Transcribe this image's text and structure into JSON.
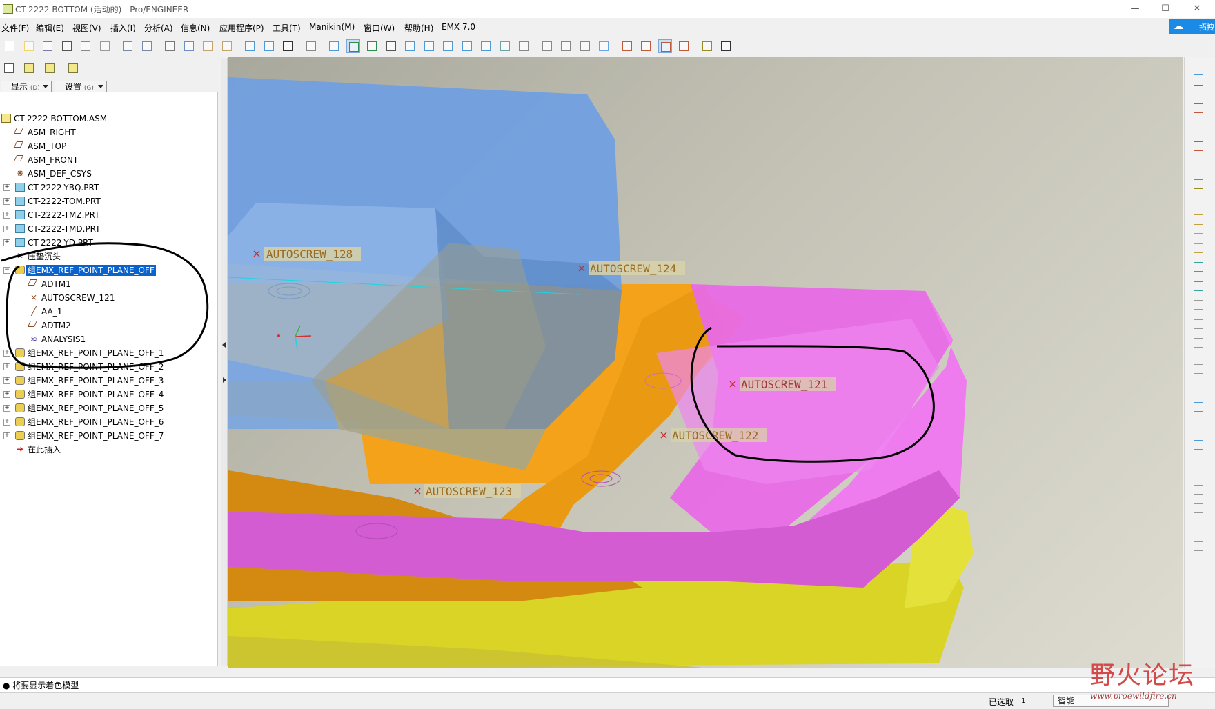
{
  "window": {
    "title": "CT-2222-BOTTOM (活动的) - Pro/ENGINEER",
    "minimize_glyph": "—",
    "maximize_glyph": "☐",
    "close_glyph": "✕"
  },
  "menubar": {
    "items": [
      "文件(F)",
      "编辑(E)",
      "视图(V)",
      "插入(I)",
      "分析(A)",
      "信息(N)",
      "应用程序(P)",
      "工具(T)",
      "Manikin(M)",
      "窗口(W)",
      "帮助(H)",
      "EMX 7.0"
    ]
  },
  "cloud_button": {
    "label": "拓拽",
    "icon": "baidu-cloud-icon"
  },
  "toolbar": {
    "icons": [
      "new-icon",
      "open-icon",
      "save-icon",
      "print-icon",
      "print-preview-icon",
      "email-icon",
      "undo-icon",
      "redo-icon",
      "cut-icon",
      "copy-icon",
      "paste-icon",
      "paste-special-icon",
      "regenerate-icon",
      "regen-manager-icon",
      "find-icon",
      "select-box-icon",
      "redraw-icon",
      "spin-center-icon",
      "orient-icon",
      "pan-icon",
      "zoom-in-icon",
      "zoom-out-icon",
      "refit-icon",
      "reorient-icon",
      "saved-views-icon",
      "layers-icon",
      "view-manager-icon",
      "wireframe-icon",
      "hidden-line-icon",
      "no-hidden-icon",
      "shading-icon",
      "datum-planes-icon",
      "datum-axes-icon",
      "datum-points-icon",
      "csys-icon",
      "annotations-icon",
      "whats-this-icon"
    ]
  },
  "left_panel": {
    "tab_icons": [
      "model-tree-icon",
      "layer-tree-icon",
      "favorites-icon",
      "browser-icon"
    ],
    "show_dropdown": {
      "label": "显示",
      "key": "(D)"
    },
    "settings_dropdown": {
      "label": "设置",
      "key": "(G)"
    }
  },
  "tree": {
    "items": [
      {
        "label": "CT-2222-BOTTOM.ASM",
        "icon": "asm"
      },
      {
        "label": "ASM_RIGHT",
        "icon": "plane"
      },
      {
        "label": "ASM_TOP",
        "icon": "plane"
      },
      {
        "label": "ASM_FRONT",
        "icon": "plane"
      },
      {
        "label": "ASM_DEF_CSYS",
        "icon": "csys"
      },
      {
        "label": "CT-2222-YBQ.PRT",
        "icon": "prt"
      },
      {
        "label": "CT-2222-TOM.PRT",
        "icon": "prt"
      },
      {
        "label": "CT-2222-TMZ.PRT",
        "icon": "prt"
      },
      {
        "label": "CT-2222-TMD.PRT",
        "icon": "prt"
      },
      {
        "label": "CT-2222-YD.PRT",
        "icon": "prt"
      },
      {
        "label": "压垫沉头",
        "icon": "ctr"
      },
      {
        "label": "组EMX_REF_POINT_PLANE_OFF",
        "icon": "grp",
        "selected": true
      },
      {
        "label": "ADTM1",
        "icon": "plane"
      },
      {
        "label": "AUTOSCREW_121",
        "icon": "pt"
      },
      {
        "label": "AA_1",
        "icon": "axis"
      },
      {
        "label": "ADTM2",
        "icon": "plane"
      },
      {
        "label": "ANALYSIS1",
        "icon": "anl"
      },
      {
        "label": "组EMX_REF_POINT_PLANE_OFF_1",
        "icon": "grp"
      },
      {
        "label": "组EMX_REF_POINT_PLANE_OFF_2",
        "icon": "grp"
      },
      {
        "label": "组EMX_REF_POINT_PLANE_OFF_3",
        "icon": "grp"
      },
      {
        "label": "组EMX_REF_POINT_PLANE_OFF_4",
        "icon": "grp"
      },
      {
        "label": "组EMX_REF_POINT_PLANE_OFF_5",
        "icon": "grp"
      },
      {
        "label": "组EMX_REF_POINT_PLANE_OFF_6",
        "icon": "grp"
      },
      {
        "label": "组EMX_REF_POINT_PLANE_OFF_7",
        "icon": "grp"
      },
      {
        "label": "在此插入",
        "icon": "ins"
      }
    ]
  },
  "viewport": {
    "labels": {
      "s128": "AUTOSCREW_128",
      "s124": "AUTOSCREW_124",
      "s121": "AUTOSCREW_121",
      "s122": "AUTOSCREW_122",
      "s123": "AUTOSCREW_123"
    },
    "colors": {
      "blue_plate": "#7aa6e0",
      "pink_plate": "#e86ae6",
      "orange_plate": "#f3a21a",
      "yellow_plate": "#d9d426",
      "screw_label_bg": "#d8d1a8",
      "screw_label_text": "#9a6a20"
    }
  },
  "right_toolbar": {
    "icons": [
      "sketch-icon",
      "datum-plane-icon",
      "datum-axis-icon",
      "datum-curve-icon",
      "datum-point-icon",
      "datum-csys-icon",
      "analysis-icon",
      "create-component-icon",
      "assemble-icon",
      "repeat-icon",
      "package-icon",
      "cut-icon",
      "hole-icon",
      "round-icon",
      "chamfer-icon",
      "shell-icon",
      "draft-icon",
      "rib-icon",
      "revolve-icon",
      "sweep-icon",
      "blend-icon",
      "mirror-icon",
      "copy-icon",
      "move-icon",
      "pattern-icon"
    ]
  },
  "message": "● 将要显示着色模型",
  "status": {
    "selected_label": "已选取",
    "selected_count": "1",
    "filter": "智能"
  },
  "watermark": {
    "title": "野火论坛",
    "url": "www.proewildfire.cn"
  }
}
